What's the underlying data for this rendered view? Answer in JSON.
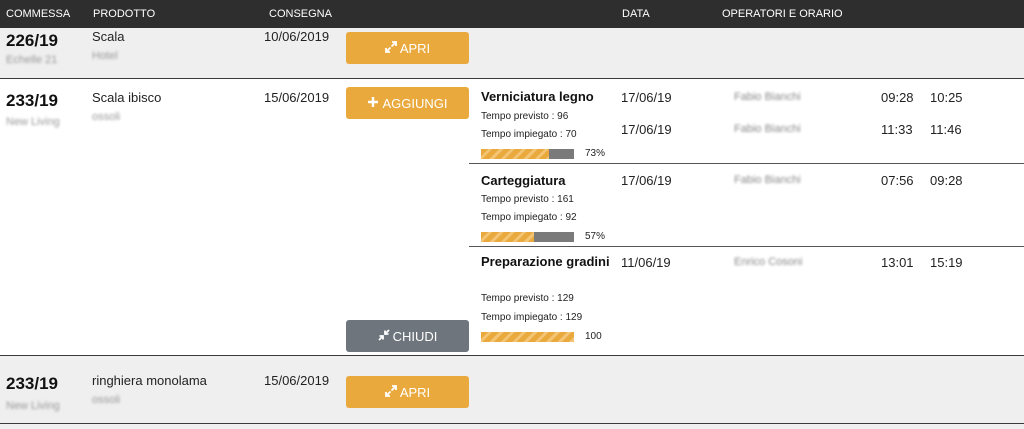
{
  "header": {
    "commessa": "COMMESSA",
    "prodotto": "PRODOTTO",
    "consegna": "CONSEGNA",
    "data": "DATA",
    "operatori": "OPERATORI E ORARIO"
  },
  "orders": [
    {
      "code": "226/19",
      "client": "Echelle 21",
      "product": "Scala",
      "product_sub": "Hotel",
      "delivery": "10/06/2019",
      "button": {
        "label": "APRI",
        "icon": "expand-icon",
        "color": "#e9a93c"
      }
    },
    {
      "code": "233/19",
      "client": "New Living",
      "product": "Scala ibisco",
      "product_sub": "ossoli",
      "delivery": "15/06/2019",
      "button": {
        "label": "AGGIUNGI",
        "icon": "plus-icon",
        "color": "#e9a93c"
      },
      "close_button": {
        "label": "CHIUDI",
        "icon": "collapse-icon",
        "color": "#6e757c"
      },
      "tasks": [
        {
          "name": "Verniciatura legno",
          "planned": "Tempo previsto : 96",
          "used": "Tempo impiegato : 70",
          "progress": 0.73,
          "progress_label": "73%",
          "entries": [
            {
              "date": "17/06/19",
              "operator": "Fabio Bianchi",
              "start": "09:28",
              "end": "10:25"
            },
            {
              "date": "17/06/19",
              "operator": "Fabio Bianchi",
              "start": "11:33",
              "end": "11:46"
            }
          ]
        },
        {
          "name": "Carteggiatura",
          "planned": "Tempo previsto : 161",
          "used": "Tempo impiegato : 92",
          "progress": 0.57,
          "progress_label": "57%",
          "entries": [
            {
              "date": "17/06/19",
              "operator": "Fabio Bianchi",
              "start": "07:56",
              "end": "09:28"
            }
          ]
        },
        {
          "name": "Preparazione gradini",
          "planned": "Tempo previsto : 129",
          "used": "Tempo impiegato : 129",
          "progress": 1.0,
          "progress_label": "100",
          "entries": [
            {
              "date": "11/06/19",
              "operator": "Enrico Cosoni",
              "start": "13:01",
              "end": "15:19"
            }
          ]
        }
      ]
    },
    {
      "code": "233/19",
      "client": "New Living",
      "product": "ringhiera monolama",
      "product_sub": "ossoli",
      "delivery": "15/06/2019",
      "button": {
        "label": "APRI",
        "icon": "expand-icon",
        "color": "#e9a93c"
      }
    }
  ]
}
